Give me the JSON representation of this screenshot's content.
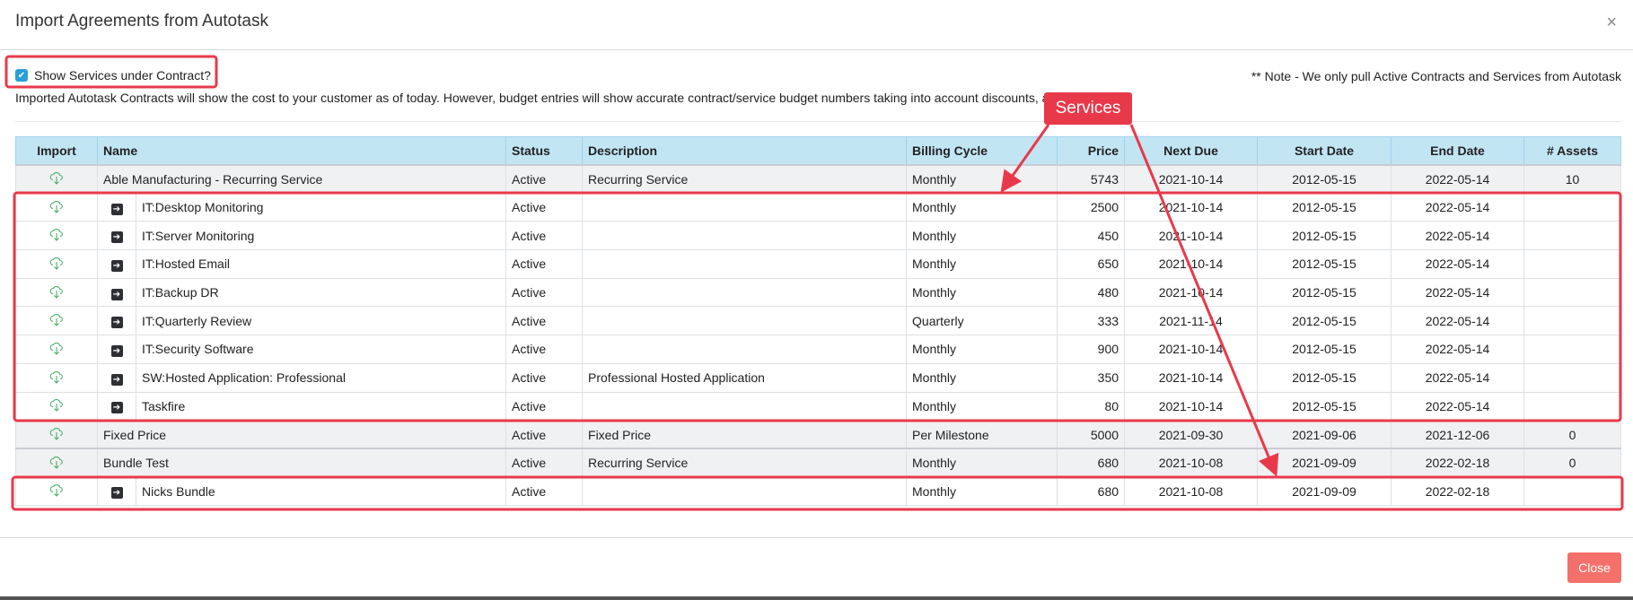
{
  "dialog": {
    "title": "Import Agreements from Autotask",
    "close_icon": "×",
    "show_services_label": "Show Services under Contract?",
    "show_services_checked": true,
    "note": "** Note - We only pull Active Contracts and Services from Autotask",
    "info": "Imported Autotask Contracts will show the cost to your customer as of today. However, budget entries will show accurate contract/service budget numbers taking into account discounts, adj",
    "close_button": "Close"
  },
  "annotation": {
    "label": "Services",
    "color": "#e8394a"
  },
  "table": {
    "headers": [
      "Import",
      "Name",
      "Status",
      "Description",
      "Billing Cycle",
      "Price",
      "Next Due",
      "Start Date",
      "End Date",
      "# Assets"
    ],
    "rows": [
      {
        "type": "contract",
        "name": "Able Manufacturing - Recurring Service",
        "status": "Active",
        "description": "Recurring Service",
        "billing": "Monthly",
        "price": "5743",
        "next_due": "2021-10-14",
        "start": "2012-05-15",
        "end": "2022-05-14",
        "assets": "10"
      },
      {
        "type": "service",
        "name": "IT:Desktop Monitoring",
        "status": "Active",
        "description": "",
        "billing": "Monthly",
        "price": "2500",
        "next_due": "2021-10-14",
        "start": "2012-05-15",
        "end": "2022-05-14",
        "assets": ""
      },
      {
        "type": "service",
        "name": "IT:Server Monitoring",
        "status": "Active",
        "description": "",
        "billing": "Monthly",
        "price": "450",
        "next_due": "2021-10-14",
        "start": "2012-05-15",
        "end": "2022-05-14",
        "assets": ""
      },
      {
        "type": "service",
        "name": "IT:Hosted Email",
        "status": "Active",
        "description": "",
        "billing": "Monthly",
        "price": "650",
        "next_due": "2021-10-14",
        "start": "2012-05-15",
        "end": "2022-05-14",
        "assets": ""
      },
      {
        "type": "service",
        "name": "IT:Backup DR",
        "status": "Active",
        "description": "",
        "billing": "Monthly",
        "price": "480",
        "next_due": "2021-10-14",
        "start": "2012-05-15",
        "end": "2022-05-14",
        "assets": ""
      },
      {
        "type": "service",
        "name": "IT:Quarterly Review",
        "status": "Active",
        "description": "",
        "billing": "Quarterly",
        "price": "333",
        "next_due": "2021-11-14",
        "start": "2012-05-15",
        "end": "2022-05-14",
        "assets": ""
      },
      {
        "type": "service",
        "name": "IT:Security Software",
        "status": "Active",
        "description": "",
        "billing": "Monthly",
        "price": "900",
        "next_due": "2021-10-14",
        "start": "2012-05-15",
        "end": "2022-05-14",
        "assets": ""
      },
      {
        "type": "service",
        "name": "SW:Hosted Application: Professional",
        "status": "Active",
        "description": "Professional Hosted Application",
        "billing": "Monthly",
        "price": "350",
        "next_due": "2021-10-14",
        "start": "2012-05-15",
        "end": "2022-05-14",
        "assets": ""
      },
      {
        "type": "service",
        "name": "Taskfire",
        "status": "Active",
        "description": "",
        "billing": "Monthly",
        "price": "80",
        "next_due": "2021-10-14",
        "start": "2012-05-15",
        "end": "2022-05-14",
        "assets": ""
      },
      {
        "type": "contract",
        "name": "Fixed Price",
        "status": "Active",
        "description": "Fixed Price",
        "billing": "Per Milestone",
        "price": "5000",
        "next_due": "2021-09-30",
        "start": "2021-09-06",
        "end": "2021-12-06",
        "assets": "0"
      },
      {
        "type": "contract",
        "name": "Bundle Test",
        "status": "Active",
        "description": "Recurring Service",
        "billing": "Monthly",
        "price": "680",
        "next_due": "2021-10-08",
        "start": "2021-09-09",
        "end": "2022-02-18",
        "assets": "0"
      },
      {
        "type": "service",
        "name": "Nicks Bundle",
        "status": "Active",
        "description": "",
        "billing": "Monthly",
        "price": "680",
        "next_due": "2021-10-08",
        "start": "2021-09-09",
        "end": "2022-02-18",
        "assets": ""
      }
    ]
  }
}
